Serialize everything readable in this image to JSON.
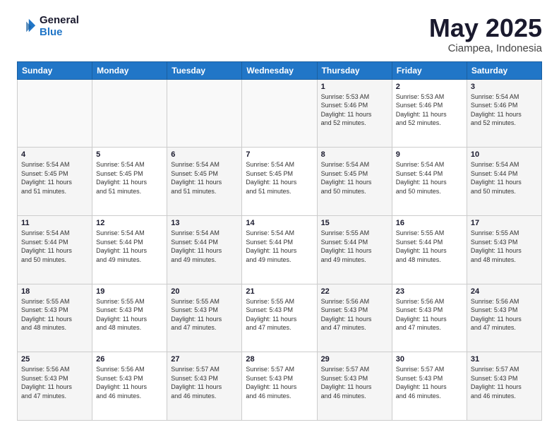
{
  "logo": {
    "line1": "General",
    "line2": "Blue"
  },
  "title": "May 2025",
  "subtitle": "Ciampea, Indonesia",
  "days_of_week": [
    "Sunday",
    "Monday",
    "Tuesday",
    "Wednesday",
    "Thursday",
    "Friday",
    "Saturday"
  ],
  "weeks": [
    [
      {
        "day": "",
        "detail": ""
      },
      {
        "day": "",
        "detail": ""
      },
      {
        "day": "",
        "detail": ""
      },
      {
        "day": "",
        "detail": ""
      },
      {
        "day": "1",
        "detail": "Sunrise: 5:53 AM\nSunset: 5:46 PM\nDaylight: 11 hours\nand 52 minutes."
      },
      {
        "day": "2",
        "detail": "Sunrise: 5:53 AM\nSunset: 5:46 PM\nDaylight: 11 hours\nand 52 minutes."
      },
      {
        "day": "3",
        "detail": "Sunrise: 5:54 AM\nSunset: 5:46 PM\nDaylight: 11 hours\nand 52 minutes."
      }
    ],
    [
      {
        "day": "4",
        "detail": "Sunrise: 5:54 AM\nSunset: 5:45 PM\nDaylight: 11 hours\nand 51 minutes."
      },
      {
        "day": "5",
        "detail": "Sunrise: 5:54 AM\nSunset: 5:45 PM\nDaylight: 11 hours\nand 51 minutes."
      },
      {
        "day": "6",
        "detail": "Sunrise: 5:54 AM\nSunset: 5:45 PM\nDaylight: 11 hours\nand 51 minutes."
      },
      {
        "day": "7",
        "detail": "Sunrise: 5:54 AM\nSunset: 5:45 PM\nDaylight: 11 hours\nand 51 minutes."
      },
      {
        "day": "8",
        "detail": "Sunrise: 5:54 AM\nSunset: 5:45 PM\nDaylight: 11 hours\nand 50 minutes."
      },
      {
        "day": "9",
        "detail": "Sunrise: 5:54 AM\nSunset: 5:44 PM\nDaylight: 11 hours\nand 50 minutes."
      },
      {
        "day": "10",
        "detail": "Sunrise: 5:54 AM\nSunset: 5:44 PM\nDaylight: 11 hours\nand 50 minutes."
      }
    ],
    [
      {
        "day": "11",
        "detail": "Sunrise: 5:54 AM\nSunset: 5:44 PM\nDaylight: 11 hours\nand 50 minutes."
      },
      {
        "day": "12",
        "detail": "Sunrise: 5:54 AM\nSunset: 5:44 PM\nDaylight: 11 hours\nand 49 minutes."
      },
      {
        "day": "13",
        "detail": "Sunrise: 5:54 AM\nSunset: 5:44 PM\nDaylight: 11 hours\nand 49 minutes."
      },
      {
        "day": "14",
        "detail": "Sunrise: 5:54 AM\nSunset: 5:44 PM\nDaylight: 11 hours\nand 49 minutes."
      },
      {
        "day": "15",
        "detail": "Sunrise: 5:55 AM\nSunset: 5:44 PM\nDaylight: 11 hours\nand 49 minutes."
      },
      {
        "day": "16",
        "detail": "Sunrise: 5:55 AM\nSunset: 5:44 PM\nDaylight: 11 hours\nand 48 minutes."
      },
      {
        "day": "17",
        "detail": "Sunrise: 5:55 AM\nSunset: 5:43 PM\nDaylight: 11 hours\nand 48 minutes."
      }
    ],
    [
      {
        "day": "18",
        "detail": "Sunrise: 5:55 AM\nSunset: 5:43 PM\nDaylight: 11 hours\nand 48 minutes."
      },
      {
        "day": "19",
        "detail": "Sunrise: 5:55 AM\nSunset: 5:43 PM\nDaylight: 11 hours\nand 48 minutes."
      },
      {
        "day": "20",
        "detail": "Sunrise: 5:55 AM\nSunset: 5:43 PM\nDaylight: 11 hours\nand 47 minutes."
      },
      {
        "day": "21",
        "detail": "Sunrise: 5:55 AM\nSunset: 5:43 PM\nDaylight: 11 hours\nand 47 minutes."
      },
      {
        "day": "22",
        "detail": "Sunrise: 5:56 AM\nSunset: 5:43 PM\nDaylight: 11 hours\nand 47 minutes."
      },
      {
        "day": "23",
        "detail": "Sunrise: 5:56 AM\nSunset: 5:43 PM\nDaylight: 11 hours\nand 47 minutes."
      },
      {
        "day": "24",
        "detail": "Sunrise: 5:56 AM\nSunset: 5:43 PM\nDaylight: 11 hours\nand 47 minutes."
      }
    ],
    [
      {
        "day": "25",
        "detail": "Sunrise: 5:56 AM\nSunset: 5:43 PM\nDaylight: 11 hours\nand 47 minutes."
      },
      {
        "day": "26",
        "detail": "Sunrise: 5:56 AM\nSunset: 5:43 PM\nDaylight: 11 hours\nand 46 minutes."
      },
      {
        "day": "27",
        "detail": "Sunrise: 5:57 AM\nSunset: 5:43 PM\nDaylight: 11 hours\nand 46 minutes."
      },
      {
        "day": "28",
        "detail": "Sunrise: 5:57 AM\nSunset: 5:43 PM\nDaylight: 11 hours\nand 46 minutes."
      },
      {
        "day": "29",
        "detail": "Sunrise: 5:57 AM\nSunset: 5:43 PM\nDaylight: 11 hours\nand 46 minutes."
      },
      {
        "day": "30",
        "detail": "Sunrise: 5:57 AM\nSunset: 5:43 PM\nDaylight: 11 hours\nand 46 minutes."
      },
      {
        "day": "31",
        "detail": "Sunrise: 5:57 AM\nSunset: 5:43 PM\nDaylight: 11 hours\nand 46 minutes."
      }
    ]
  ]
}
